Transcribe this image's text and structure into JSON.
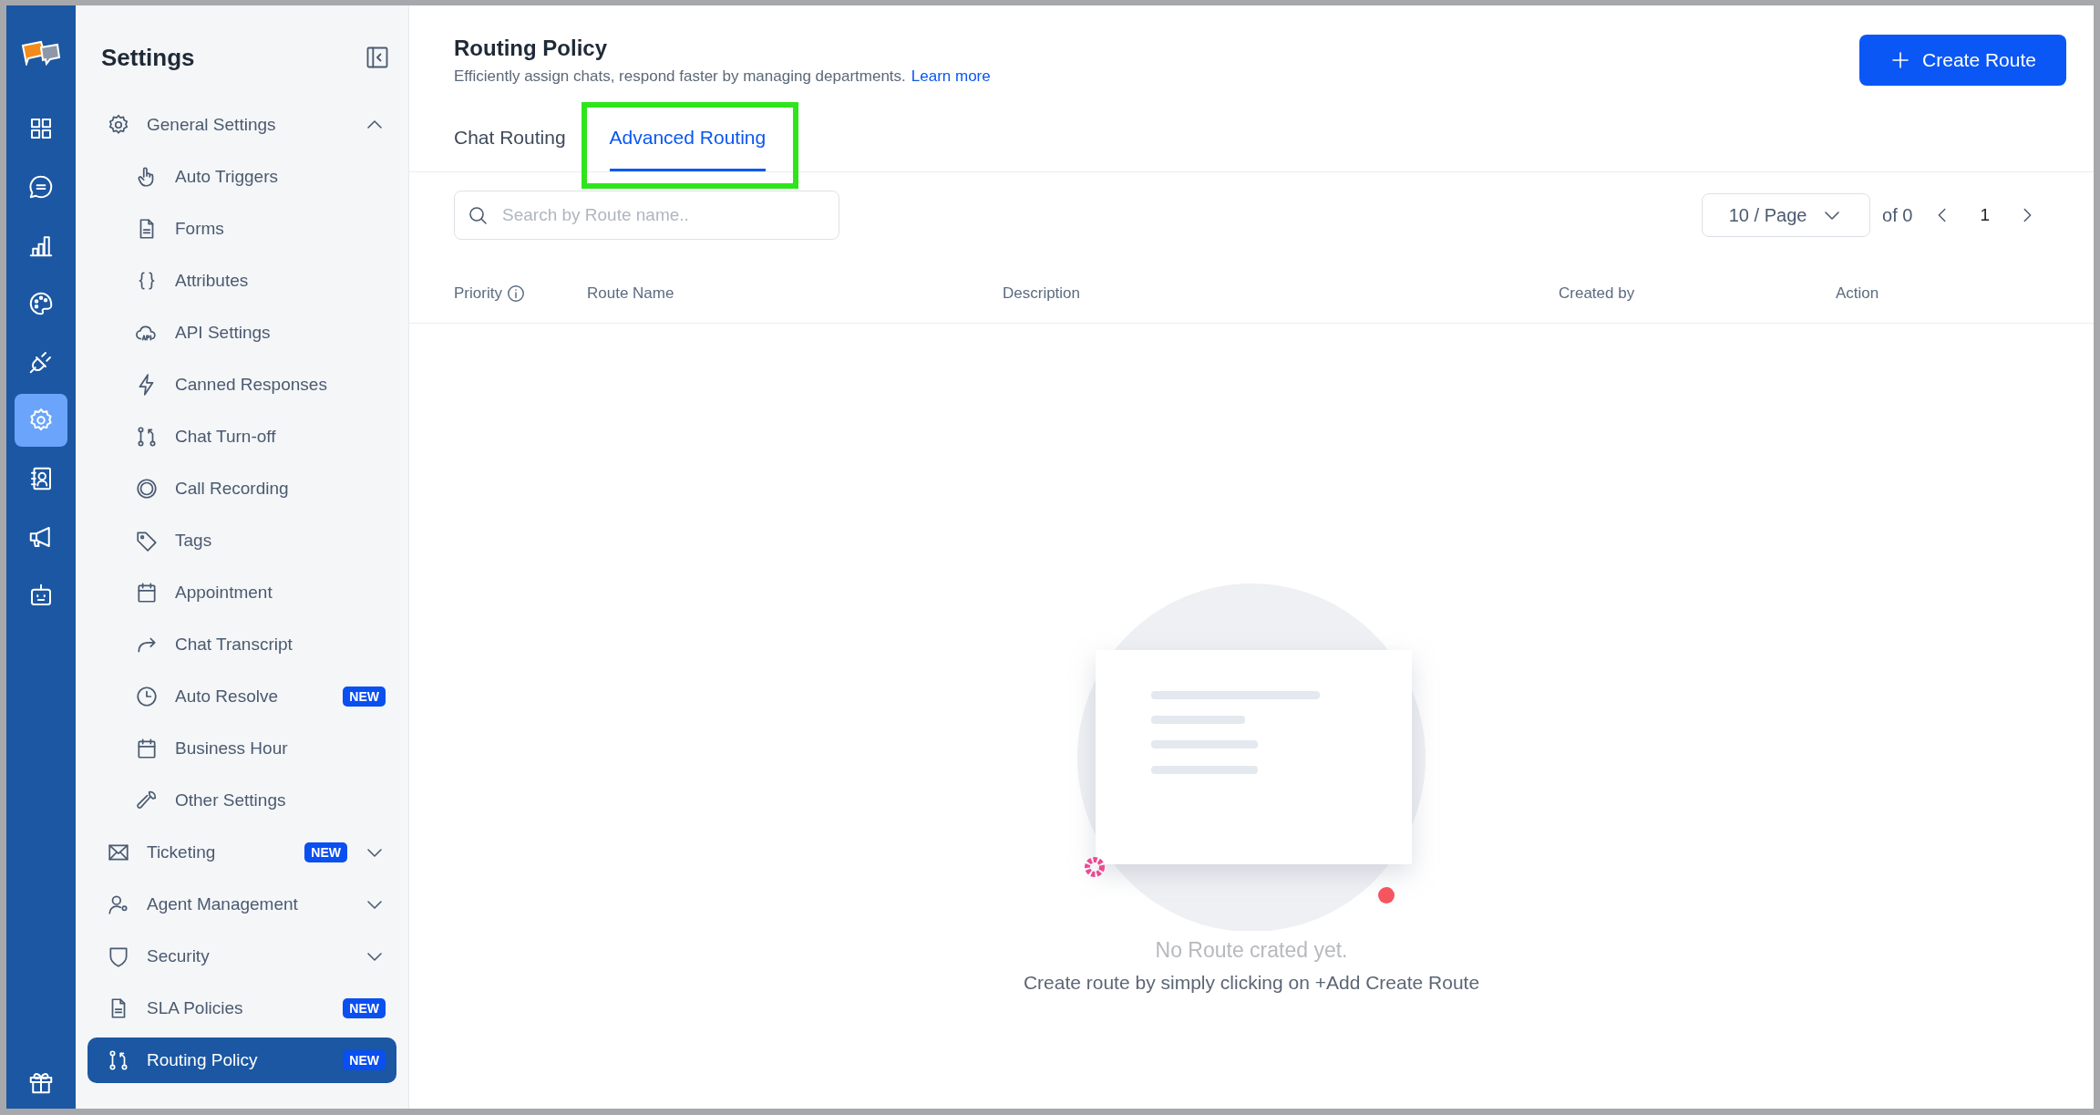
{
  "rail": {
    "items": [
      {
        "selected": false
      },
      {
        "selected": false
      },
      {
        "selected": false
      },
      {
        "selected": false
      },
      {
        "selected": false
      },
      {
        "selected": true
      },
      {
        "selected": false
      },
      {
        "selected": false
      },
      {
        "selected": false
      }
    ]
  },
  "sidebar": {
    "title": "Settings",
    "items": [
      {
        "label": "General Settings",
        "selected": false,
        "expanded": true,
        "children": [
          {
            "label": "Auto Triggers",
            "selected": false
          },
          {
            "label": "Forms",
            "selected": false
          },
          {
            "label": "Attributes",
            "selected": false
          },
          {
            "label": "API Settings",
            "selected": false
          },
          {
            "label": "Canned Responses",
            "selected": false
          },
          {
            "label": "Chat Turn-off",
            "selected": false
          },
          {
            "label": "Call Recording",
            "selected": false
          },
          {
            "label": "Tags",
            "selected": false
          },
          {
            "label": "Appointment",
            "selected": false
          },
          {
            "label": "Chat Transcript",
            "selected": false
          },
          {
            "label": "Auto Resolve",
            "selected": false,
            "badge": "NEW"
          },
          {
            "label": "Business Hour",
            "selected": false
          },
          {
            "label": "Other Settings",
            "selected": false
          }
        ]
      },
      {
        "label": "Ticketing",
        "selected": false,
        "badge": "NEW",
        "expanded": false
      },
      {
        "label": "Agent Management",
        "selected": false,
        "expanded": false
      },
      {
        "label": "Security",
        "selected": false,
        "expanded": false
      },
      {
        "label": "SLA Policies",
        "selected": false,
        "badge": "NEW"
      },
      {
        "label": "Routing Policy",
        "selected": true,
        "badge": "NEW"
      }
    ]
  },
  "header": {
    "title": "Routing Policy",
    "description": "Efficiently assign chats, respond faster by managing departments.",
    "link": "Learn more",
    "button": "Create Route"
  },
  "tabs": [
    {
      "label": "Chat Routing",
      "selected": false,
      "highlighted": false
    },
    {
      "label": "Advanced Routing",
      "selected": true,
      "highlighted": true
    }
  ],
  "search": {
    "placeholder": "Search by Route name.."
  },
  "pagination": {
    "page_size": "10 / Page",
    "total": "of 0",
    "page": "1"
  },
  "table": {
    "columns": [
      "Priority",
      "Route Name",
      "Description",
      "Created by",
      "Action"
    ]
  },
  "empty_state": {
    "title": "No Route crated yet.",
    "text": "Create route by simply clicking on +Add Create Route"
  }
}
